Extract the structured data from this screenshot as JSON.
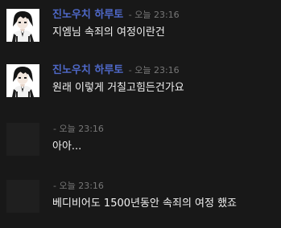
{
  "colors": {
    "background": "#181818",
    "author": "#4f69c9",
    "timestamp": "#777777",
    "message": "#f1f1f1",
    "avatar_placeholder": "#1f1f1f"
  },
  "messages": [
    {
      "author": "진노우치 하루토",
      "separator": "-",
      "time": "오늘 23:16",
      "text": "지엠님 속죄의 여정이란건",
      "avatar_icon": "anime-character-avatar-icon"
    },
    {
      "author": "진노우치 하루토",
      "separator": "-",
      "time": "오늘 23:16",
      "text": "원래 이렇게 거칠고힘든건가요",
      "avatar_icon": "anime-character-avatar-icon"
    },
    {
      "author": "",
      "separator": "-",
      "time": "오늘 23:16",
      "text": "아아...",
      "avatar_icon": "avatar-placeholder-icon"
    },
    {
      "author": "",
      "separator": "-",
      "time": "오늘 23:16",
      "text": "베디비어도 1500년동안 속죄의 여정 했죠",
      "avatar_icon": "avatar-placeholder-icon"
    }
  ]
}
